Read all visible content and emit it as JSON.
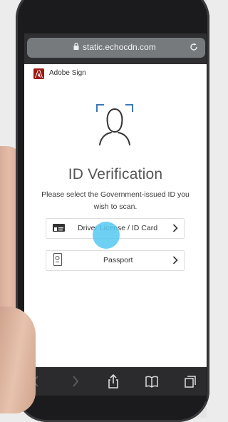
{
  "browser": {
    "url": "static.echocdn.com"
  },
  "app": {
    "brand": "Adobe Sign",
    "brand_color": "#9b1a12"
  },
  "main": {
    "title": "ID Verification",
    "instructions": "Please select the Government-issued ID you wish to scan."
  },
  "options": [
    {
      "label": "Driver License / ID Card",
      "icon": "id-card-icon"
    },
    {
      "label": "Passport",
      "icon": "passport-icon"
    }
  ],
  "toolbar": {
    "buttons": [
      "back-icon",
      "forward-icon",
      "share-icon",
      "bookmarks-icon",
      "tabs-icon"
    ]
  },
  "colors": {
    "accent_touch": "#55c8f0"
  }
}
